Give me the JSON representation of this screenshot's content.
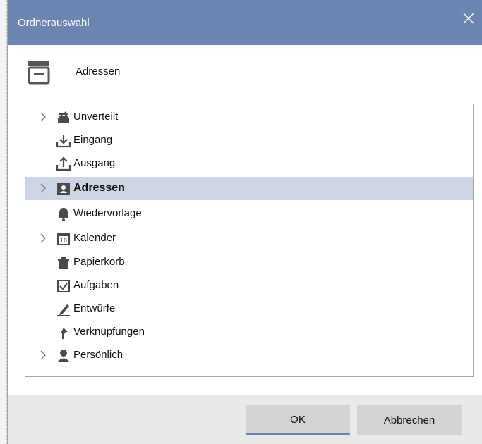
{
  "dialog": {
    "title": "Ordnerauswahl",
    "close_icon": "close-icon",
    "accent_color": "#6c86b2"
  },
  "header": {
    "icon": "cabinet-icon",
    "label": "Adressen"
  },
  "tree": {
    "selected_color": "#cdd4e3",
    "items": [
      {
        "label": "Unverteilt",
        "icon": "unsorted-icon",
        "expandable": true,
        "selected": false
      },
      {
        "label": "Eingang",
        "icon": "inbox-icon",
        "expandable": false,
        "selected": false
      },
      {
        "label": "Ausgang",
        "icon": "outbox-icon",
        "expandable": false,
        "selected": false
      },
      {
        "label": "Adressen",
        "icon": "contact-card-icon",
        "expandable": true,
        "selected": true
      },
      {
        "label": "Wiedervorlage",
        "icon": "bell-icon",
        "expandable": false,
        "selected": false
      },
      {
        "label": "Kalender",
        "icon": "calendar-icon",
        "expandable": true,
        "selected": false,
        "icon_text": "10"
      },
      {
        "label": "Papierkorb",
        "icon": "trash-icon",
        "expandable": false,
        "selected": false
      },
      {
        "label": "Aufgaben",
        "icon": "checkbox-icon",
        "expandable": false,
        "selected": false
      },
      {
        "label": "Entwürfe",
        "icon": "pencil-icon",
        "expandable": false,
        "selected": false
      },
      {
        "label": "Verknüpfungen",
        "icon": "link-arrow-icon",
        "expandable": false,
        "selected": false
      },
      {
        "label": "Persönlich",
        "icon": "person-icon",
        "expandable": true,
        "selected": false
      }
    ]
  },
  "footer": {
    "ok_label": "OK",
    "cancel_label": "Abbrechen"
  }
}
